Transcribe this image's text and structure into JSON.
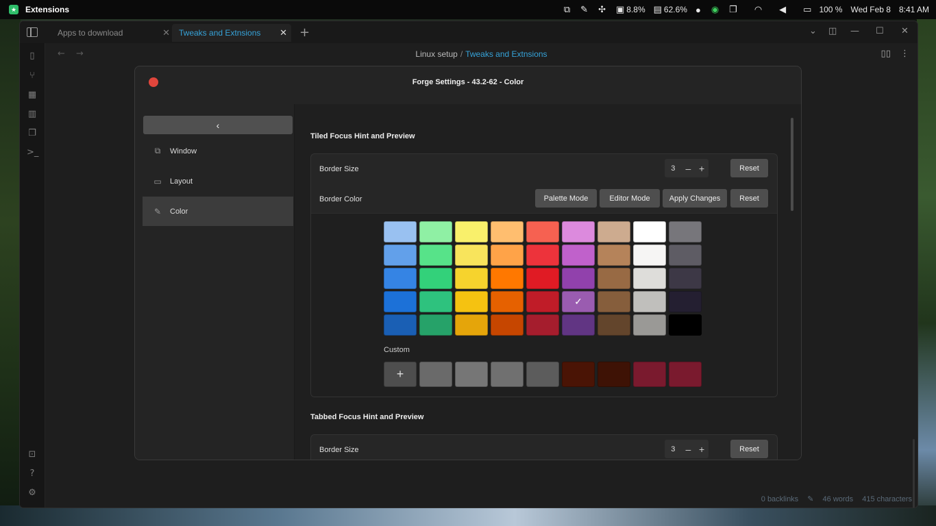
{
  "topbar": {
    "app_name": "Extensions",
    "tray": [
      {
        "icon": "window-switch-icon",
        "glyph": "⧉",
        "text": ""
      },
      {
        "icon": "color-picker-icon",
        "glyph": "✎",
        "text": ""
      },
      {
        "icon": "puzzle-icon",
        "glyph": "✣",
        "text": ""
      },
      {
        "icon": "disk-icon",
        "glyph": "▣",
        "text": "8.8%"
      },
      {
        "icon": "memory-icon",
        "glyph": "▤",
        "text": "62.6%"
      },
      {
        "icon": "status-face-icon",
        "glyph": "●",
        "text": ""
      },
      {
        "icon": "whatsapp-icon",
        "glyph": "◉",
        "text": ""
      },
      {
        "icon": "clipboard-icon",
        "glyph": "❐",
        "text": ""
      },
      {
        "icon": "wifi-icon",
        "glyph": "◠",
        "text": ""
      },
      {
        "icon": "volume-icon",
        "glyph": "◀",
        "text": ""
      },
      {
        "icon": "battery-icon",
        "glyph": "▭",
        "text": "100 %"
      }
    ],
    "date": "Wed Feb 8",
    "time": "8:41 AM"
  },
  "tabs": [
    {
      "label": "Apps to download",
      "close": "✕"
    },
    {
      "label": "Tweaks and Extnsions",
      "close": "✕"
    }
  ],
  "new_tab": "+",
  "breadcrumb": {
    "parent": "Linux setup",
    "separator": "/",
    "current": "Tweaks and Extnsions"
  },
  "status_bar": {
    "backlinks": "0 backlinks",
    "words": "46 words",
    "characters": "415 characters"
  },
  "dialog": {
    "title": "Forge Settings - 43.2-62 - Color",
    "back": "‹",
    "nav": [
      {
        "label": "Window",
        "icon": "window-icon",
        "glyph": "⧉"
      },
      {
        "label": "Layout",
        "icon": "monitor-icon",
        "glyph": "▭"
      },
      {
        "label": "Color",
        "icon": "color-picker-icon",
        "glyph": "✎"
      }
    ],
    "tiled": {
      "title": "Tiled Focus Hint and Preview",
      "border_size_label": "Border Size",
      "border_size_value": "3",
      "minus": "–",
      "plus": "+",
      "reset": "Reset",
      "border_color_label": "Border Color",
      "palette_mode": "Palette Mode",
      "editor_mode": "Editor Mode",
      "apply_changes": "Apply Changes",
      "reset2": "Reset",
      "palette": [
        [
          "#99c1f1",
          "#8ff0a4",
          "#f9f06b",
          "#ffbe6f",
          "#f66151",
          "#dc8add",
          "#cdab8f",
          "#ffffff",
          "#77767b"
        ],
        [
          "#62a0ea",
          "#57e389",
          "#f8e45c",
          "#ffa348",
          "#ed333b",
          "#c061cb",
          "#b5835a",
          "#f6f5f4",
          "#5e5c64"
        ],
        [
          "#3584e4",
          "#33d17a",
          "#f6d32d",
          "#ff7800",
          "#e01b24",
          "#9141ac",
          "#986a44",
          "#deddda",
          "#3d3846"
        ],
        [
          "#1c71d8",
          "#2ec27e",
          "#f5c211",
          "#e66100",
          "#c01c28",
          "#9a5cb0",
          "#865e3c",
          "#c0bfbc",
          "#241f31"
        ],
        [
          "#1a5fb4",
          "#26a269",
          "#e5a50a",
          "#c64600",
          "#a51d2d",
          "#613583",
          "#63452c",
          "#9a9996",
          "#000000"
        ]
      ],
      "selected_check": "✓",
      "custom_label": "Custom",
      "custom_add": "+",
      "custom_colors": [
        "#6a6a6a",
        "#767676",
        "#707070",
        "#5c5c5c",
        "#4a1405",
        "#3e1205",
        "#7a1a2e",
        "#7a1a2e"
      ]
    },
    "tabbed": {
      "title": "Tabbed Focus Hint and Preview",
      "border_size_label": "Border Size",
      "border_size_value": "3",
      "minus": "–",
      "plus": "+",
      "reset": "Reset"
    }
  }
}
